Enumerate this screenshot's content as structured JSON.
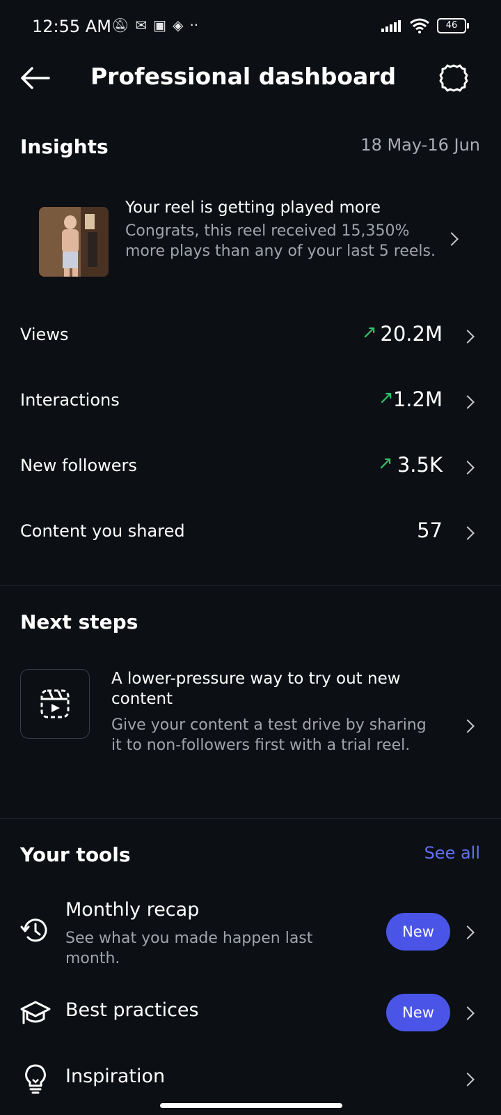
{
  "status_bar": {
    "time": "12:55 AM",
    "battery": "46"
  },
  "header": {
    "title": "Professional dashboard"
  },
  "insights": {
    "title": "Insights",
    "date_range": "18 May-16 Jun",
    "reel": {
      "title": "Your reel is getting played more",
      "description": "Congrats, this reel received 15,350% more plays than any of your last 5 reels."
    },
    "metrics": [
      {
        "label": "Views",
        "value": "20.2M",
        "trend": "up"
      },
      {
        "label": "Interactions",
        "value": "1.2M",
        "trend": "up"
      },
      {
        "label": "New followers",
        "value": "3.5K",
        "trend": "up"
      },
      {
        "label": "Content you shared",
        "value": "57",
        "trend": "none"
      }
    ]
  },
  "next_steps": {
    "title": "Next steps",
    "card": {
      "title": "A lower-pressure way to try out new content",
      "description": "Give your content a test drive by sharing it to non-followers first with a trial reel."
    }
  },
  "tools": {
    "title": "Your tools",
    "see_all": "See all",
    "items": [
      {
        "title": "Monthly recap",
        "description": "See what you made happen last month.",
        "badge": "New",
        "icon": "history-icon"
      },
      {
        "title": "Best practices",
        "description": "",
        "badge": "New",
        "icon": "graduation-cap-icon"
      },
      {
        "title": "Inspiration",
        "description": "",
        "badge": "",
        "icon": "lightbulb-icon"
      }
    ]
  },
  "colors": {
    "background": "#0c0f14",
    "accent": "#4a55e8",
    "link": "#6170f5",
    "trend_up": "#2fc56a"
  }
}
